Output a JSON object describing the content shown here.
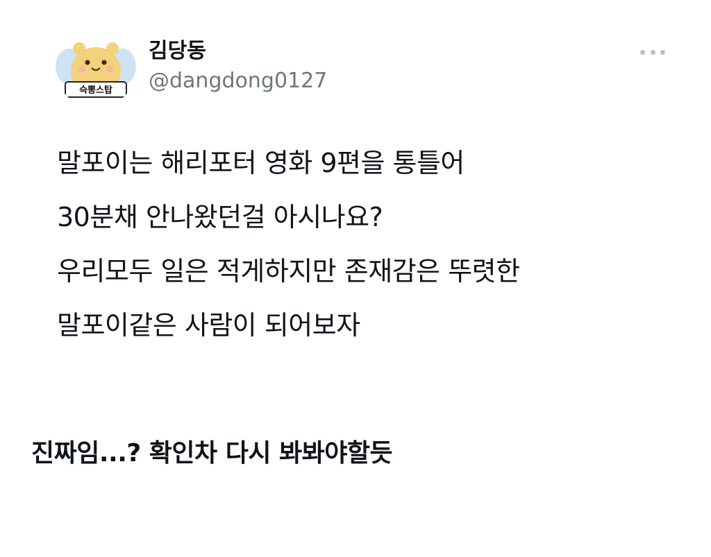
{
  "author": {
    "name": "김당동",
    "handle": "@dangdong0127",
    "avatar_text": "슥뽕스탑"
  },
  "more_icon": "more-horizontal-icon",
  "tweet": {
    "lines": [
      "말포이는 해리포터 영화 9편을 통틀어",
      "30분채 안나왔던걸 아시나요?",
      "우리모두 일은 적게하지만 존재감은 뚜렷한",
      "말포이같은 사람이 되어보자"
    ]
  },
  "caption": "진짜임...? 확인차 다시 봐봐야할듯",
  "colors": {
    "text": "#0f1419",
    "secondary": "#6e767d",
    "avatar_yellow": "#f2d27a",
    "avatar_wing": "#cfe2f5"
  }
}
